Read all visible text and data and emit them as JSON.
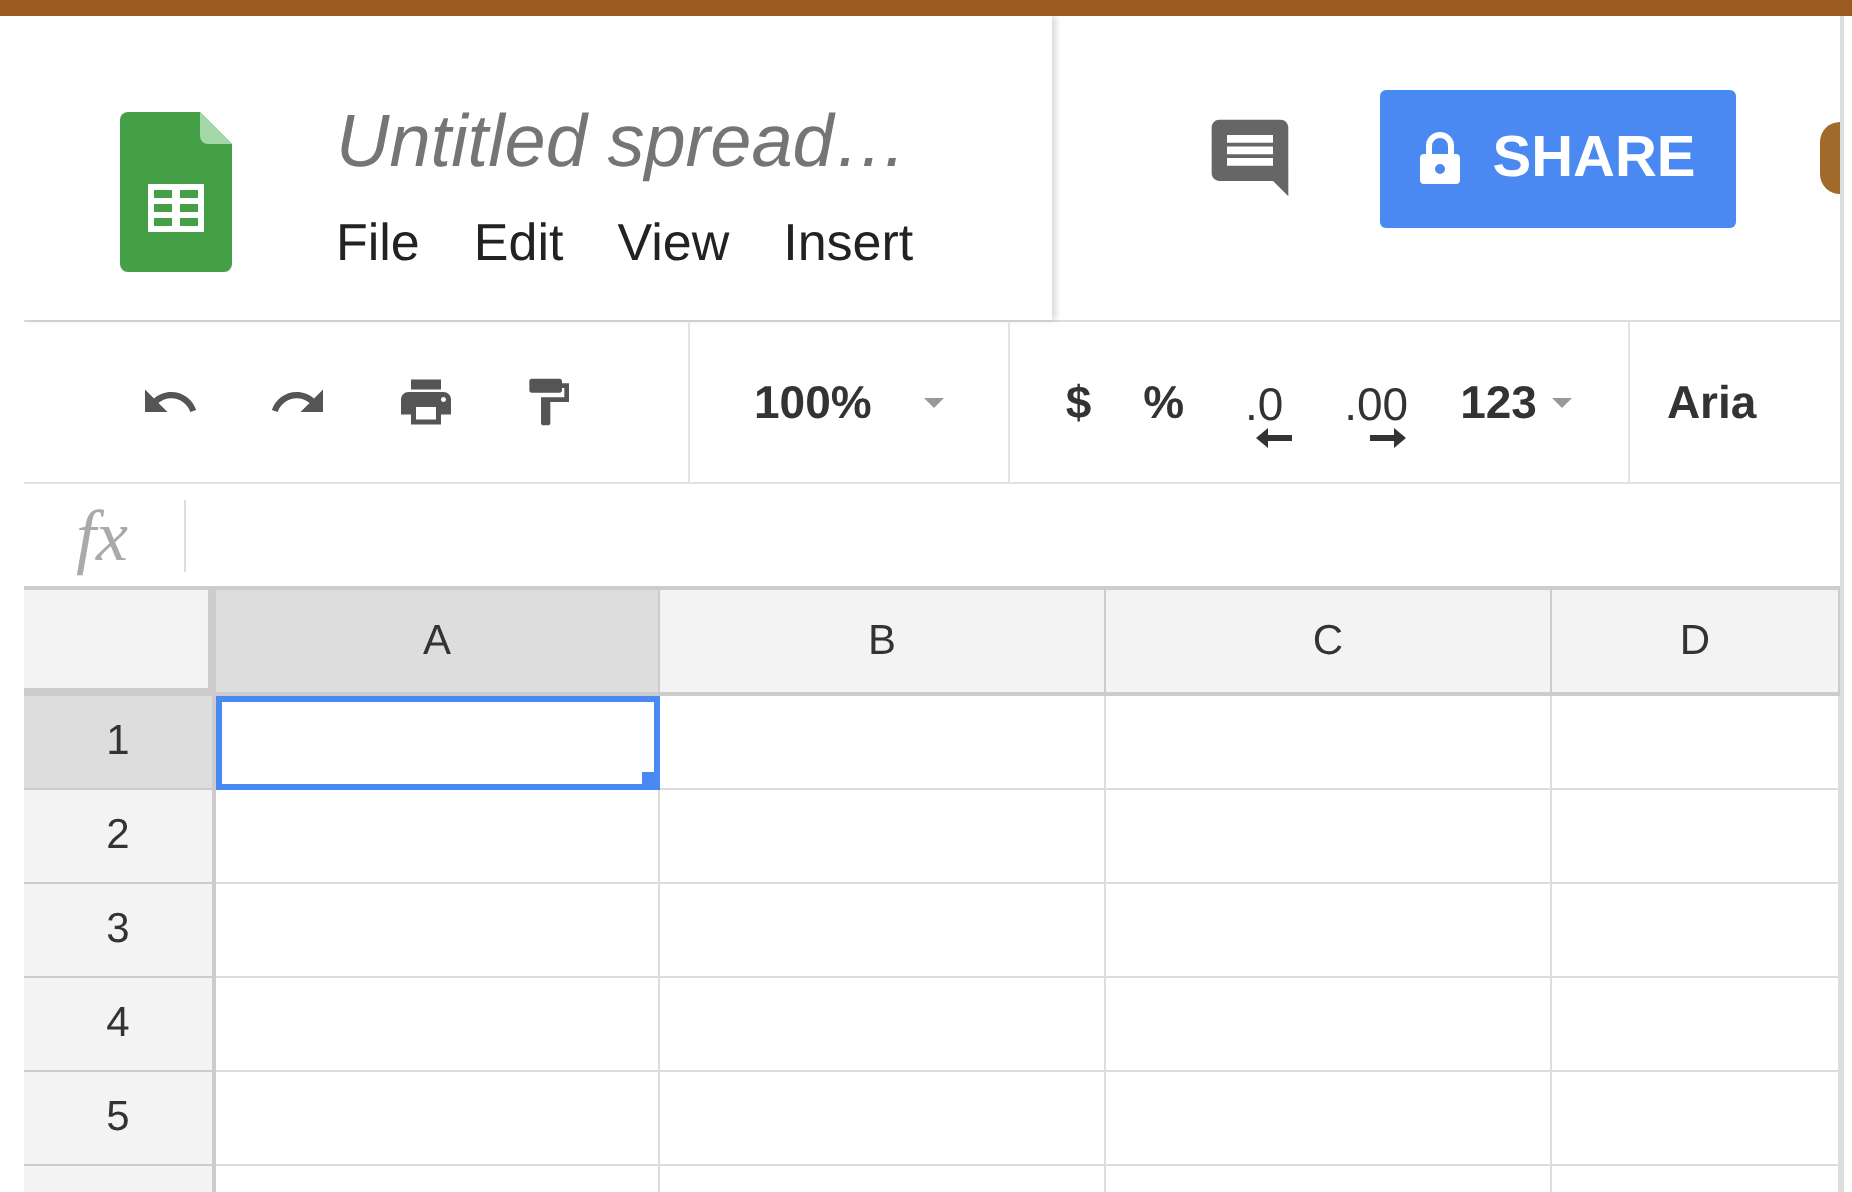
{
  "document": {
    "title": "Untitled spread…",
    "menu": [
      "File",
      "Edit",
      "View",
      "Insert"
    ]
  },
  "share_button": {
    "label": "SHARE"
  },
  "toolbar": [
    {
      "items": [
        {
          "kind": "undo"
        },
        {
          "kind": "redo"
        },
        {
          "kind": "print"
        },
        {
          "kind": "paint-format"
        }
      ]
    },
    {
      "items": [
        {
          "kind": "dropdown",
          "label": "100%"
        }
      ]
    },
    {
      "items": [
        {
          "kind": "text",
          "label": "$"
        },
        {
          "kind": "text",
          "label": "%"
        },
        {
          "kind": "decimal-decrease",
          "label": ".0"
        },
        {
          "kind": "decimal-increase",
          "label": ".00"
        },
        {
          "kind": "dropdown",
          "label": "123"
        }
      ]
    },
    {
      "items": [
        {
          "kind": "text",
          "label": "Aria"
        }
      ]
    }
  ],
  "formula_bar": {
    "label": "fx"
  },
  "columns": [
    {
      "label": "A",
      "selected": true
    },
    {
      "label": "B",
      "selected": false
    },
    {
      "label": "C",
      "selected": false
    },
    {
      "label": "D",
      "selected": false
    }
  ],
  "rows": [
    {
      "label": "1",
      "selected": true,
      "cells": [
        {
          "selected": true
        },
        {
          "selected": false
        },
        {
          "selected": false
        },
        {
          "selected": false
        }
      ]
    },
    {
      "label": "2",
      "selected": false,
      "cells": [
        {
          "selected": false
        },
        {
          "selected": false
        },
        {
          "selected": false
        },
        {
          "selected": false
        }
      ]
    },
    {
      "label": "3",
      "selected": false,
      "cells": [
        {
          "selected": false
        },
        {
          "selected": false
        },
        {
          "selected": false
        },
        {
          "selected": false
        }
      ]
    },
    {
      "label": "4",
      "selected": false,
      "cells": [
        {
          "selected": false
        },
        {
          "selected": false
        },
        {
          "selected": false
        },
        {
          "selected": false
        }
      ]
    },
    {
      "label": "5",
      "selected": false,
      "cells": [
        {
          "selected": false
        },
        {
          "selected": false
        },
        {
          "selected": false
        },
        {
          "selected": false
        }
      ]
    }
  ]
}
